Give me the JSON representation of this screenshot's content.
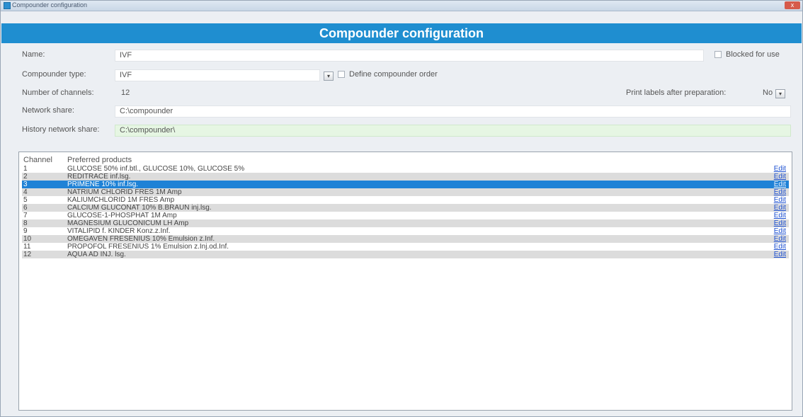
{
  "window": {
    "title": "Compounder configuration",
    "banner_title": "Compounder configuration",
    "close_label": "x"
  },
  "form": {
    "name_label": "Name:",
    "name_value": "IVF",
    "blocked_label": "Blocked for use",
    "compounder_type_label": "Compounder type:",
    "compounder_type_value": "IVF",
    "compounder_type_dropdown": "▾",
    "define_order_label": "Define compounder order",
    "channels_label": "Number of channels:",
    "channels_value": "12",
    "print_labels_label": "Print labels after preparation:",
    "print_labels_value": "No",
    "print_labels_dropdown": "▾",
    "network_share_label": "Network share:",
    "network_share_value": "C:\\compounder",
    "history_share_label": "History network share:",
    "history_share_value": "C:\\compounder\\"
  },
  "table": {
    "headers": {
      "channel": "Channel",
      "products": "Preferred products"
    },
    "edit_label": "Edit",
    "rows": [
      {
        "channel": "1",
        "products": "GLUCOSE 50% inf.btl., GLUCOSE 10%, GLUCOSE 5%"
      },
      {
        "channel": "2",
        "products": "REDITRACE inf.lsg."
      },
      {
        "channel": "3",
        "products": "PRIMENE 10% inf.lsg."
      },
      {
        "channel": "4",
        "products": "NATRIUM CHLORID FRES 1M Amp"
      },
      {
        "channel": "5",
        "products": "KALIUMCHLORID 1M FRES Amp"
      },
      {
        "channel": "6",
        "products": "CALCIUM GLUCONAT 10% B.BRAUN inj.lsg."
      },
      {
        "channel": "7",
        "products": "GLUCOSE-1-PHOSPHAT 1M Amp"
      },
      {
        "channel": "8",
        "products": "MAGNESIUM GLUCONICUM LH Amp"
      },
      {
        "channel": "9",
        "products": "VITALIPID f. KINDER Konz.z.Inf."
      },
      {
        "channel": "10",
        "products": "OMEGAVEN FRESENIUS 10% Emulsion z.Inf."
      },
      {
        "channel": "11",
        "products": "PROPOFOL FRESENIUS 1% Emulsion z.Inj.od.Inf."
      },
      {
        "channel": "12",
        "products": "AQUA AD INJ. lsg."
      }
    ],
    "selected_index": 2
  },
  "colors": {
    "banner": "#1f8ed0",
    "selected_row": "#1f82d6",
    "history_field": "#e6f6e3"
  }
}
